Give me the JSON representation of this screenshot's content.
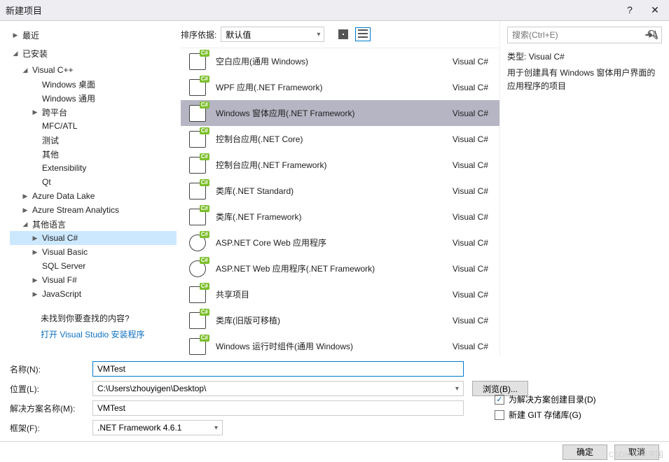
{
  "titlebar": {
    "title": "新建项目"
  },
  "sidebar": {
    "recent": "最近",
    "installed": "已安装",
    "vcpp": "Visual C++",
    "vcpp_items": [
      "Windows 桌面",
      "Windows 通用",
      "跨平台",
      "MFC/ATL",
      "测试",
      "其他",
      "Extensibility",
      "Qt"
    ],
    "azure_data": "Azure Data Lake",
    "azure_stream": "Azure Stream Analytics",
    "other_lang": "其他语言",
    "other_items": [
      "Visual C#",
      "Visual Basic",
      "SQL Server",
      "Visual F#",
      "JavaScript"
    ],
    "not_found": "未找到你要查找的内容?",
    "open_installer": "打开 Visual Studio 安装程序"
  },
  "center": {
    "sort_label": "排序依据:",
    "sort_value": "默认值",
    "templates": [
      {
        "name": "空白应用(通用 Windows)",
        "type": "Visual C#"
      },
      {
        "name": "WPF 应用(.NET Framework)",
        "type": "Visual C#"
      },
      {
        "name": "Windows 窗体应用(.NET Framework)",
        "type": "Visual C#",
        "selected": true
      },
      {
        "name": "控制台应用(.NET Core)",
        "type": "Visual C#"
      },
      {
        "name": "控制台应用(.NET Framework)",
        "type": "Visual C#"
      },
      {
        "name": "类库(.NET Standard)",
        "type": "Visual C#"
      },
      {
        "name": "类库(.NET Framework)",
        "type": "Visual C#"
      },
      {
        "name": "ASP.NET Core Web 应用程序",
        "type": "Visual C#",
        "globe": true
      },
      {
        "name": "ASP.NET Web 应用程序(.NET Framework)",
        "type": "Visual C#",
        "globe": true
      },
      {
        "name": "共享项目",
        "type": "Visual C#"
      },
      {
        "name": "类库(旧版可移植)",
        "type": "Visual C#"
      },
      {
        "name": "Windows 运行时组件(通用 Windows)",
        "type": "Visual C#"
      }
    ]
  },
  "right": {
    "search_placeholder": "搜索(Ctrl+E)",
    "type_prefix": "类型:",
    "type_value": "Visual C#",
    "description": "用于创建具有 Windows 窗体用户界面的应用程序的项目"
  },
  "details": {
    "name_label": "名称(N):",
    "name_value": "VMTest",
    "location_label": "位置(L):",
    "location_value": "C:\\Users\\zhouyigen\\Desktop\\",
    "solution_label": "解决方案名称(M):",
    "solution_value": "VMTest",
    "framework_label": "框架(F):",
    "framework_value": ".NET Framework 4.6.1",
    "browse": "浏览(B)...",
    "create_dir": "为解决方案创建目录(D)",
    "create_git": "新建 GIT 存储库(G)"
  },
  "footer": {
    "ok": "确定",
    "cancel": "取消"
  },
  "watermark": "CSDN @吴粥国"
}
